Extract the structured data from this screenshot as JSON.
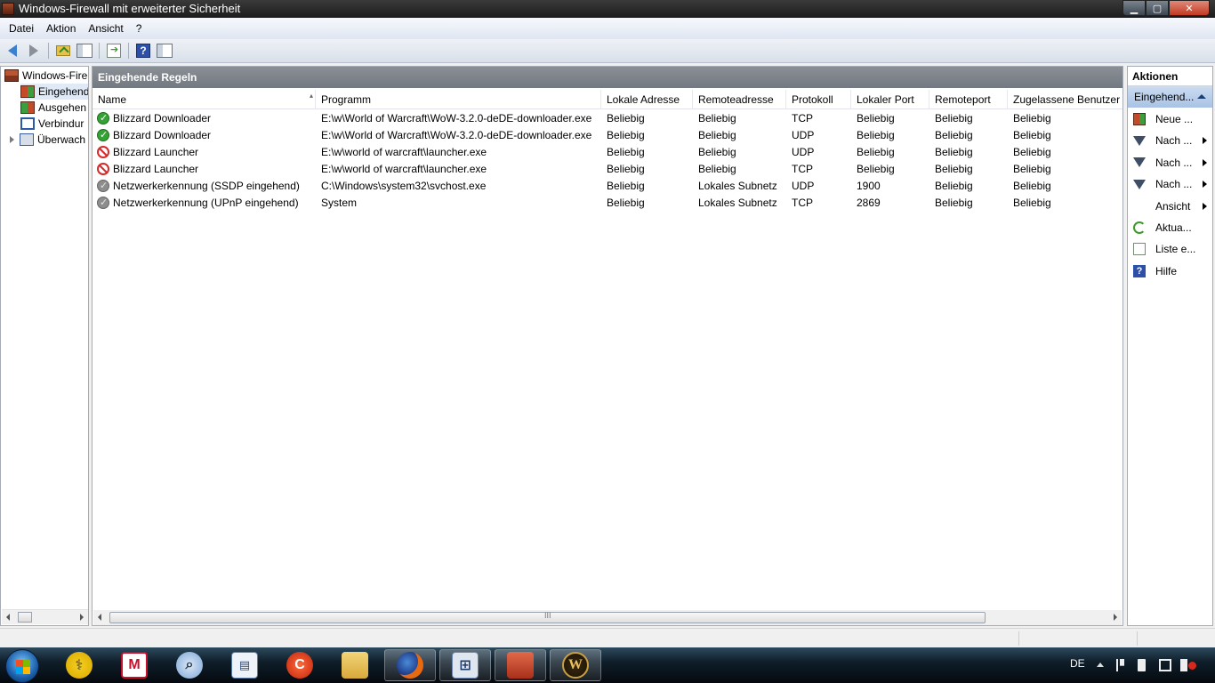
{
  "window": {
    "title": "Windows-Firewall mit erweiterter Sicherheit",
    "controls": {
      "minimize": "▁",
      "maximize": "▢",
      "close": "✕"
    }
  },
  "menu": [
    "Datei",
    "Aktion",
    "Ansicht",
    "?"
  ],
  "toolbar": {
    "buttons": [
      "back-arrow-icon",
      "forward-arrow-icon",
      "up-folder-icon",
      "show-hide-console-tree-icon",
      "export-list-icon",
      "help-icon",
      "show-hide-action-pane-icon"
    ]
  },
  "tree": {
    "root": "Windows-Fire",
    "items": [
      {
        "label": "Eingehend",
        "icon": "inbound-rules-icon",
        "selected": true
      },
      {
        "label": "Ausgehen",
        "icon": "outbound-rules-icon"
      },
      {
        "label": "Verbindur",
        "icon": "connection-security-icon"
      },
      {
        "label": "Überwach",
        "icon": "monitoring-icon",
        "expandable": true
      }
    ]
  },
  "main": {
    "header": "Eingehende Regeln",
    "columns": [
      "Name",
      "Programm",
      "Lokale Adresse",
      "Remoteadresse",
      "Protokoll",
      "Lokaler Port",
      "Remoteport",
      "Zugelassene Benutzer"
    ],
    "rows": [
      {
        "status": "allow",
        "cells": [
          "Blizzard Downloader",
          "E:\\w\\World of Warcraft\\WoW-3.2.0-deDE-downloader.exe",
          "Beliebig",
          "Beliebig",
          "TCP",
          "Beliebig",
          "Beliebig",
          "Beliebig"
        ]
      },
      {
        "status": "allow",
        "cells": [
          "Blizzard Downloader",
          "E:\\w\\World of Warcraft\\WoW-3.2.0-deDE-downloader.exe",
          "Beliebig",
          "Beliebig",
          "UDP",
          "Beliebig",
          "Beliebig",
          "Beliebig"
        ]
      },
      {
        "status": "block",
        "cells": [
          "Blizzard Launcher",
          "E:\\w\\world of warcraft\\launcher.exe",
          "Beliebig",
          "Beliebig",
          "UDP",
          "Beliebig",
          "Beliebig",
          "Beliebig"
        ]
      },
      {
        "status": "block",
        "cells": [
          "Blizzard Launcher",
          "E:\\w\\world of warcraft\\launcher.exe",
          "Beliebig",
          "Beliebig",
          "TCP",
          "Beliebig",
          "Beliebig",
          "Beliebig"
        ]
      },
      {
        "status": "disabled",
        "cells": [
          "Netzwerkerkennung (SSDP eingehend)",
          "C:\\Windows\\system32\\svchost.exe",
          "Beliebig",
          "Lokales Subnetz",
          "UDP",
          "1900",
          "Beliebig",
          "Beliebig"
        ]
      },
      {
        "status": "disabled",
        "cells": [
          "Netzwerkerkennung (UPnP eingehend)",
          "System",
          "Beliebig",
          "Lokales Subnetz",
          "TCP",
          "2869",
          "Beliebig",
          "Beliebig"
        ]
      }
    ],
    "scroll_grip": "III"
  },
  "actions": {
    "title": "Aktionen",
    "section": "Eingehend...",
    "items": [
      {
        "label": "Neue ...",
        "icon": "new-rule-icon",
        "submenu": false
      },
      {
        "label": "Nach ...",
        "icon": "filter-icon",
        "submenu": true
      },
      {
        "label": "Nach ...",
        "icon": "filter-icon",
        "submenu": true
      },
      {
        "label": "Nach ...",
        "icon": "filter-icon",
        "submenu": true
      },
      {
        "label": "Ansicht",
        "icon": "",
        "submenu": true
      },
      {
        "label": "Aktua...",
        "icon": "refresh-icon",
        "submenu": false
      },
      {
        "label": "Liste e...",
        "icon": "export-list-icon",
        "submenu": false
      },
      {
        "label": "Hilfe",
        "icon": "help-icon",
        "submenu": false
      }
    ]
  },
  "taskbar": {
    "apps": [
      "start-orb",
      "doctor-stethoscope-icon",
      "mcafee-icon",
      "magnifier-icon",
      "document-icon",
      "ccleaner-icon",
      "explorer-folder-icon",
      "firefox-icon",
      "network-icon",
      "firewall-toolbox-icon",
      "warcraft-icon"
    ],
    "language": "DE",
    "tray_icons": [
      "show-hidden-icons-arrow",
      "action-center-flag-icon",
      "power-icon",
      "network-tray-icon",
      "volume-muted-icon"
    ]
  },
  "colors": {
    "header_bg": "#7d828a",
    "selection_bg": "#dfe9f7",
    "allow": "#34a234",
    "block": "#d42a2a",
    "disabled": "#8d8d8d"
  }
}
